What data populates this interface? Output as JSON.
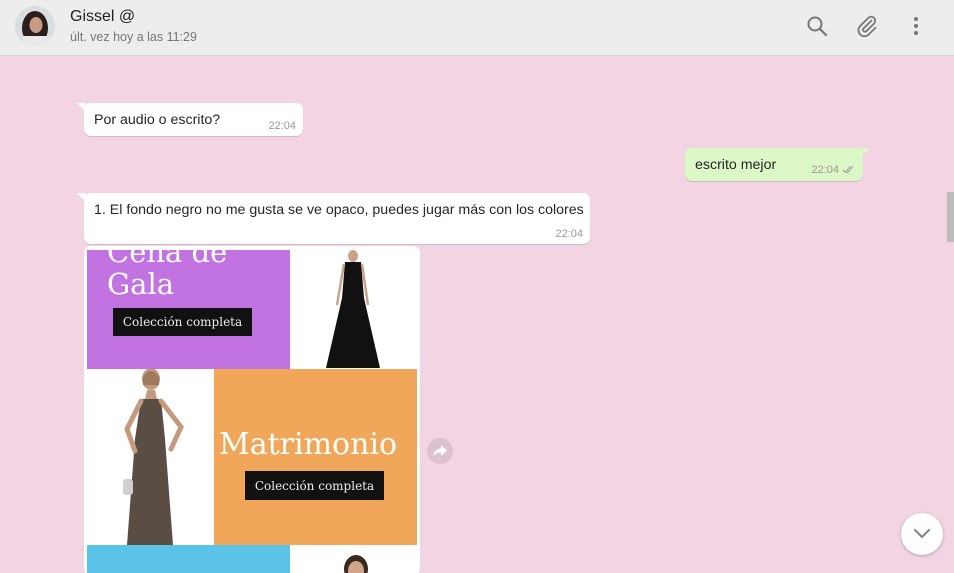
{
  "header": {
    "contact_name": "Gissel @",
    "last_seen": "últ. vez hoy a las 11:29",
    "icons": [
      "search-icon",
      "attach-icon",
      "menu-icon"
    ]
  },
  "messages": [
    {
      "direction": "in",
      "text": "Por audio o escrito?",
      "time": "22:04"
    },
    {
      "direction": "out",
      "text": "escrito mejor",
      "time": "22:04",
      "status": "read"
    },
    {
      "direction": "in",
      "text": "1. El fondo negro no me gusta se ve opaco, puedes jugar más con los colores",
      "time": "22:04"
    }
  ],
  "image_message": {
    "tiles": {
      "gala_title_line1": "Cena de",
      "gala_title_line2": "Gala",
      "gala_cta": "Colección completa",
      "matrimonio_title": "Matrimonio",
      "matrimonio_cta": "Colección completa"
    },
    "colors": {
      "purple": "#c273e2",
      "orange": "#f0a75a",
      "blue": "#5bc3e8"
    }
  },
  "colors": {
    "chat_background": "#f2d4e2",
    "incoming_bubble": "#ffffff",
    "outgoing_bubble": "#dcf8c6",
    "header": "#ededed"
  }
}
